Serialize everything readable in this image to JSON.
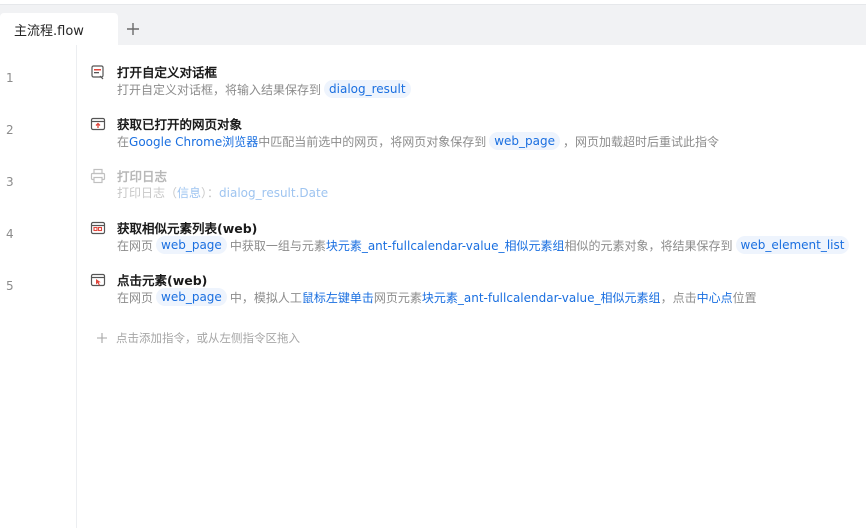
{
  "tab": {
    "label": "主流程.flow"
  },
  "line_numbers": [
    "1",
    "2",
    "3",
    "4",
    "5"
  ],
  "steps": [
    {
      "title": "打开自定义对话框",
      "icon": "dialog-icon",
      "desc": {
        "t1": "打开自定义对话框，将输入结果保存到",
        "c1": "dialog_result"
      }
    },
    {
      "title": "获取已打开的网页对象",
      "icon": "browser-window-icon",
      "desc": {
        "t1": "在",
        "b1": "Google Chrome浏览器",
        "t2": "中匹配当前选中的网页，将网页对象保存到",
        "c1": "web_page",
        "t3": "，网页加载超时后重试此指令"
      }
    },
    {
      "title": "打印日志",
      "icon": "printer-icon",
      "desc": {
        "t1": "打印日志（",
        "b1": "信息",
        "t2": "）：",
        "b2": "dialog_result.Date"
      }
    },
    {
      "title": "获取相似元素列表(web)",
      "icon": "similar-elements-icon",
      "desc": {
        "t1": "在网页",
        "c1": "web_page",
        "t2": "中获取一组与元素",
        "b1": "块元素_ant-fullcalendar-value_相似元素组",
        "t3": "相似的元素对象，将结果保存到",
        "c2": "web_element_list"
      }
    },
    {
      "title": "点击元素(web)",
      "icon": "click-element-icon",
      "desc": {
        "t1": "在网页",
        "c1": "web_page",
        "t2": "中，模拟人工",
        "b1": "鼠标左键单击",
        "t3": "网页元素",
        "b2": "块元素_ant-fullcalendar-value_相似元素组",
        "t4": "，点击",
        "b3": "中心点",
        "t5": "位置"
      }
    }
  ],
  "add_hint": "点击添加指令，或从左侧指令区拖入",
  "colors": {
    "accent": "#1a6fe0",
    "chip_bg": "#eef4fd",
    "icon_red": "#e0463c"
  }
}
